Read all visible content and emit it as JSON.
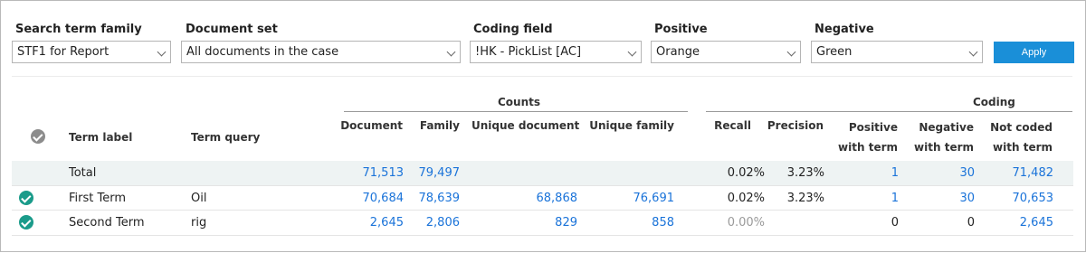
{
  "filters": {
    "search_term_family": {
      "label": "Search term family",
      "value": "STF1 for Report"
    },
    "document_set": {
      "label": "Document set",
      "value": "All documents in the case"
    },
    "coding_field": {
      "label": "Coding field",
      "value": "!HK - PickList [AC]"
    },
    "positive": {
      "label": "Positive",
      "value": "Orange"
    },
    "negative": {
      "label": "Negative",
      "value": "Green"
    },
    "apply_label": "Apply"
  },
  "table": {
    "groups": {
      "counts": "Counts",
      "coding": "Coding"
    },
    "headers": {
      "term_label": "Term label",
      "term_query": "Term query",
      "document": "Document",
      "family": "Family",
      "unique_document": "Unique document",
      "unique_family": "Unique family",
      "recall": "Recall",
      "precision": "Precision",
      "positive_line1": "Positive",
      "positive_line2": "with term",
      "negative_line1": "Negative",
      "negative_line2": "with term",
      "notcoded_line1": "Not coded",
      "notcoded_line2": "with term"
    },
    "rows": [
      {
        "label": "Total",
        "query": "",
        "document": "71,513",
        "family": "79,497",
        "unique_document": "",
        "unique_family": "",
        "recall": "0.02%",
        "precision": "3.23%",
        "positive": "1",
        "negative": "30",
        "not_coded": "71,482"
      },
      {
        "label": "First Term",
        "query": "Oil",
        "document": "70,684",
        "family": "78,639",
        "unique_document": "68,868",
        "unique_family": "76,691",
        "recall": "0.02%",
        "precision": "3.23%",
        "positive": "1",
        "negative": "30",
        "not_coded": "70,653"
      },
      {
        "label": "Second Term",
        "query": "rig",
        "document": "2,645",
        "family": "2,806",
        "unique_document": "829",
        "unique_family": "858",
        "recall": "0.00%",
        "precision": "",
        "positive": "0",
        "negative": "0",
        "not_coded": "2,645"
      }
    ]
  },
  "colors": {
    "accent": "#1a8fd8",
    "link": "#1a73d9",
    "check": "#1a9b8a",
    "total_row": "#eef3f3"
  }
}
